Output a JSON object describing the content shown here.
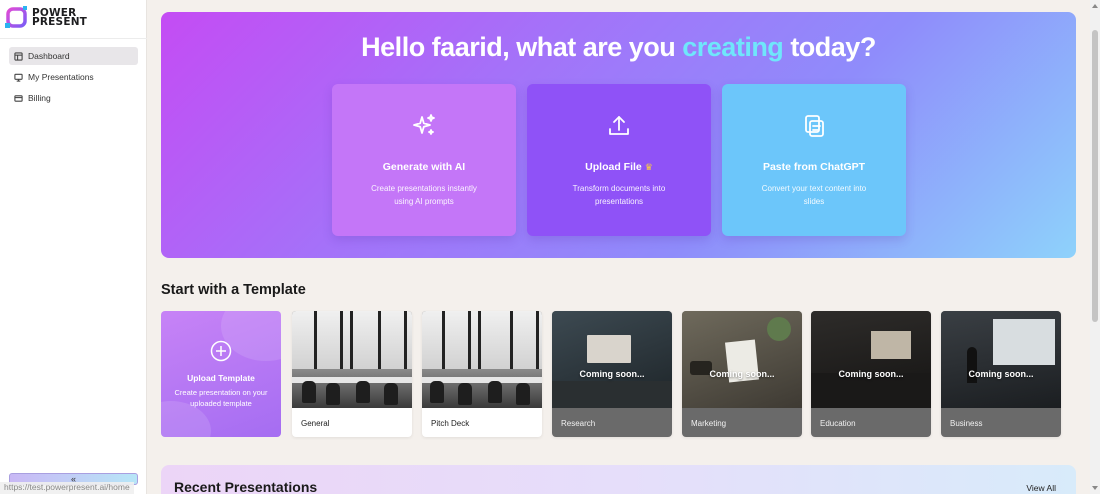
{
  "app": {
    "logo_line1": "POWER",
    "logo_line2": "PRESENT",
    "brand_color": "#a855f7"
  },
  "sidebar": {
    "items": [
      {
        "label": "Dashboard",
        "icon": "layout-icon",
        "active": true
      },
      {
        "label": "My Presentations",
        "icon": "monitor-icon",
        "active": false
      },
      {
        "label": "Billing",
        "icon": "card-icon",
        "active": false
      }
    ],
    "collapse_glyph": "«"
  },
  "status_bar": {
    "url": "https://test.powerpresent.ai/home"
  },
  "hero": {
    "title_prefix": "Hello faarid, what are you ",
    "title_accent": "creating",
    "title_suffix": " today?",
    "accent_color": "#6fe6fb",
    "options": [
      {
        "title": "Generate with AI",
        "description": "Create presentations instantly using AI prompts",
        "icon": "sparkles-icon"
      },
      {
        "title": "Upload File",
        "description": "Transform documents into presentations",
        "icon": "upload-icon",
        "badge": "crown-icon"
      },
      {
        "title": "Paste from ChatGPT",
        "description": "Convert your text content into slides",
        "icon": "paste-icon"
      }
    ]
  },
  "templates": {
    "section_title": "Start with a Template",
    "upload": {
      "title": "Upload Template",
      "description": "Create presentation on your uploaded template"
    },
    "items": [
      {
        "label": "General",
        "coming_soon": ""
      },
      {
        "label": "Pitch Deck",
        "coming_soon": ""
      },
      {
        "label": "Research",
        "coming_soon": "Coming soon..."
      },
      {
        "label": "Marketing",
        "coming_soon": "Coming soon..."
      },
      {
        "label": "Education",
        "coming_soon": "Coming soon..."
      },
      {
        "label": "Business",
        "coming_soon": "Coming soon..."
      }
    ]
  },
  "recent": {
    "title": "Recent Presentations",
    "view_all": "View All"
  }
}
